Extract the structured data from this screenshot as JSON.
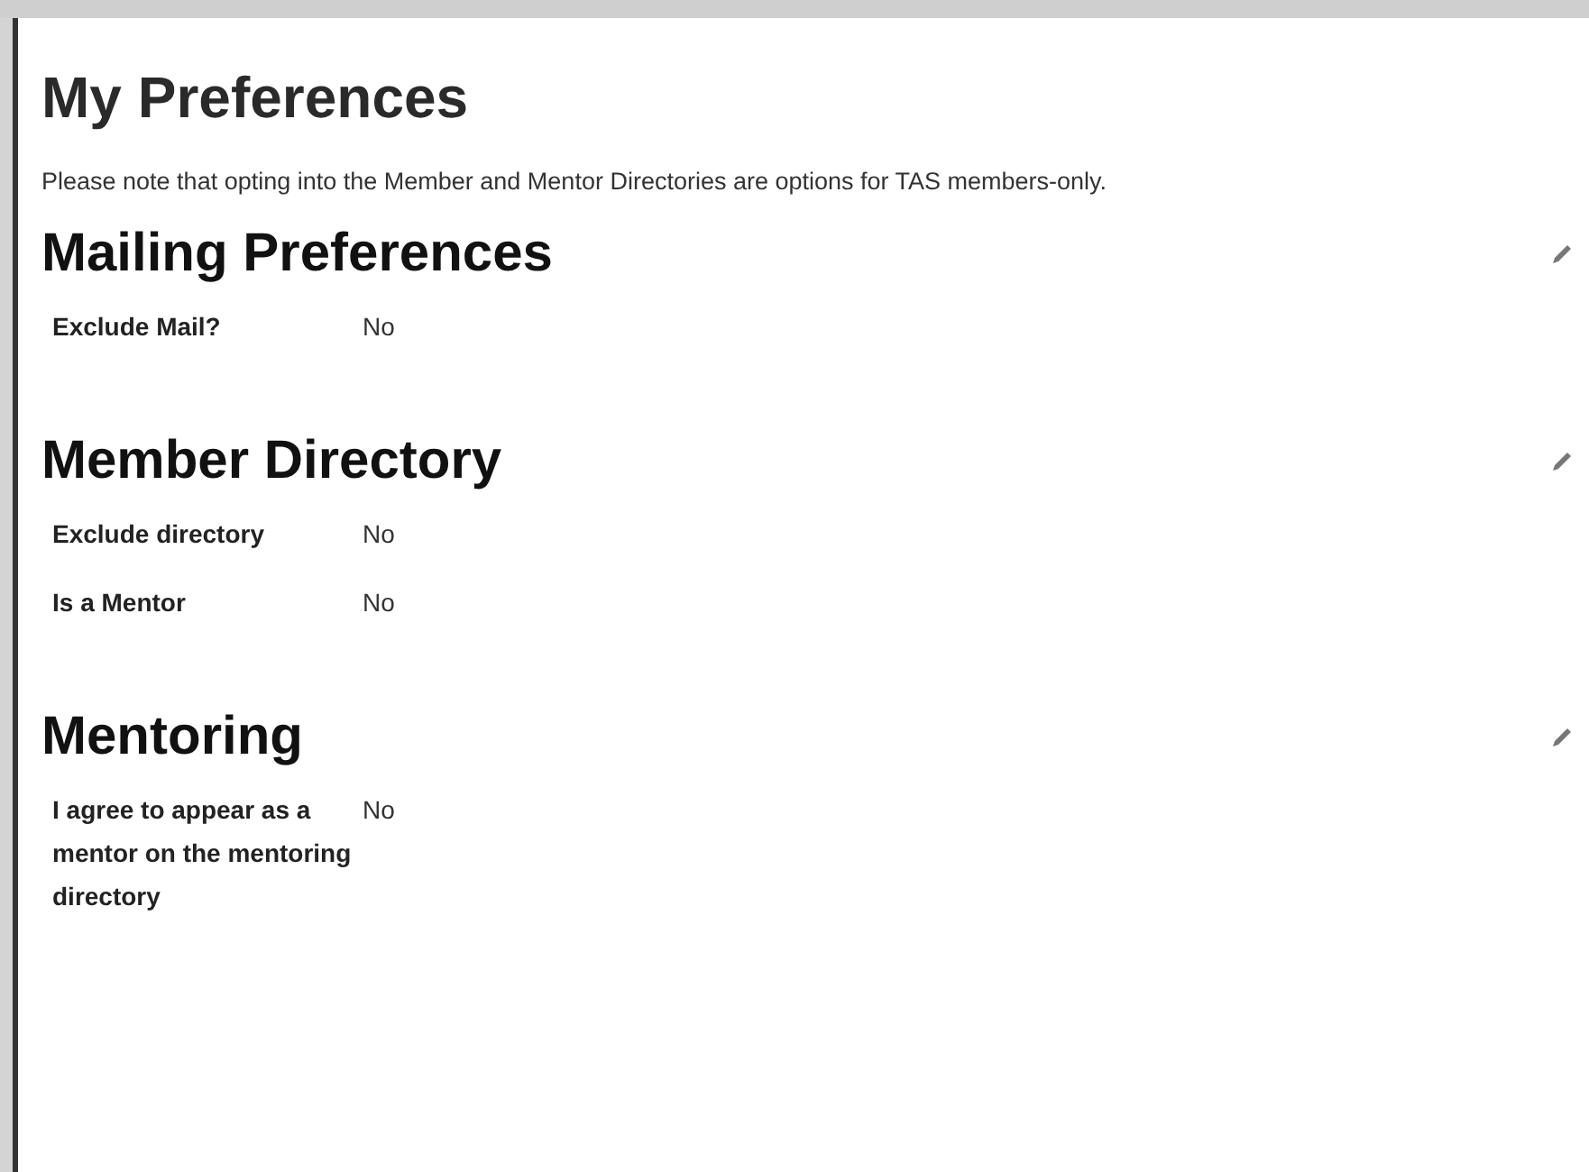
{
  "page": {
    "title": "My Preferences",
    "note": "Please note that opting into the Member and Mentor Directories are options for TAS members-only."
  },
  "sections": [
    {
      "title": "Mailing Preferences",
      "fields": [
        {
          "label": "Exclude Mail?",
          "value": "No"
        }
      ]
    },
    {
      "title": "Member Directory",
      "fields": [
        {
          "label": "Exclude directory",
          "value": "No"
        },
        {
          "label": "Is a Mentor",
          "value": "No"
        }
      ]
    },
    {
      "title": "Mentoring",
      "fields": [
        {
          "label": "I agree to appear as a mentor on the mentoring directory",
          "value": "No"
        }
      ]
    }
  ]
}
